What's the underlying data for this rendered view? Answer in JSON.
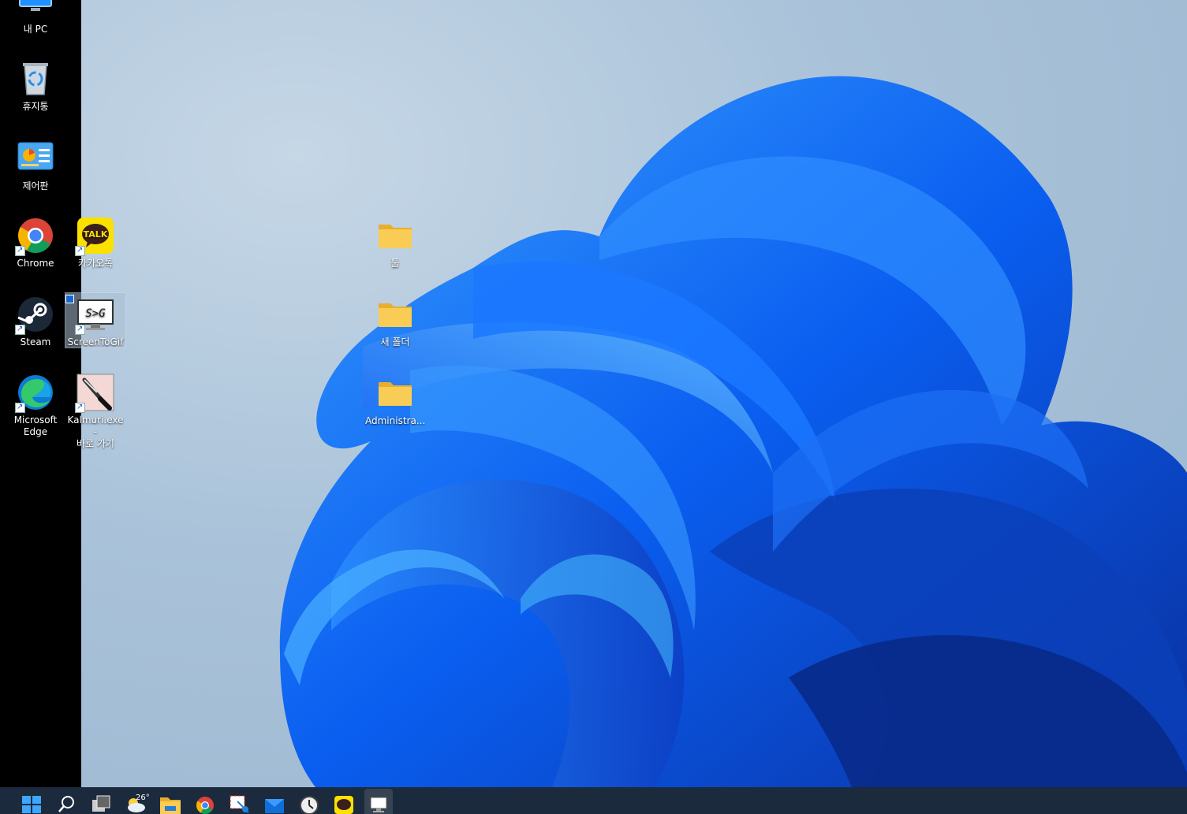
{
  "desktop_icons": {
    "my_pc": {
      "label": "내 PC"
    },
    "recycle_bin": {
      "label": "휴지통"
    },
    "control_panel": {
      "label": "제어판"
    },
    "chrome": {
      "label": "Chrome"
    },
    "kakaotalk": {
      "label": "카카오톡",
      "badge": "TALK"
    },
    "steam": {
      "label": "Steam"
    },
    "screentogif": {
      "label": "ScreenToGif",
      "badge": "S>G"
    },
    "edge": {
      "label_line1": "Microsoft",
      "label_line2": "Edge"
    },
    "kalmuri": {
      "label_line1": "Kalmuri.exe -",
      "label_line2": "바로 가기"
    }
  },
  "folders": [
    {
      "label": "툴"
    },
    {
      "label": "새 폴더"
    },
    {
      "label": "Administra..."
    }
  ],
  "taskbar": {
    "weather_temp": "26°",
    "items": [
      "start",
      "search",
      "task-view",
      "weather",
      "file-explorer",
      "chrome",
      "snipping-tool",
      "mail",
      "clock",
      "kakaotalk",
      "screentogif"
    ]
  },
  "colors": {
    "taskbar": "#1b2a3c",
    "accent": "#0a6cff",
    "folder": "#f5c84a"
  }
}
